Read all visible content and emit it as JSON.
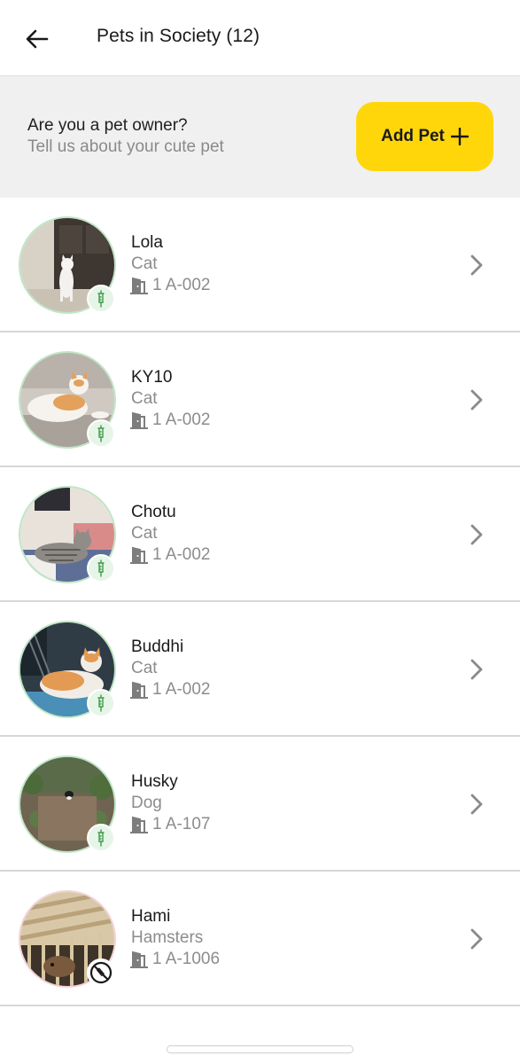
{
  "header": {
    "title": "Pets in Society (12)",
    "back_icon": "arrow-left-icon"
  },
  "banner": {
    "question": "Are you a pet owner?",
    "subtitle": "Tell us about your cute pet",
    "add_button_label": "Add Pet",
    "add_button_icon": "plus-icon",
    "accent_color": "#ffd60a"
  },
  "pets": [
    {
      "name": "Lola",
      "type": "Cat",
      "unit": "1 A-002",
      "vaccinated": true
    },
    {
      "name": "KY10",
      "type": "Cat",
      "unit": "1 A-002",
      "vaccinated": true
    },
    {
      "name": "Chotu",
      "type": "Cat",
      "unit": "1 A-002",
      "vaccinated": true
    },
    {
      "name": "Buddhi",
      "type": "Cat",
      "unit": "1 A-002",
      "vaccinated": true
    },
    {
      "name": "Husky",
      "type": "Dog",
      "unit": "1 A-107",
      "vaccinated": true
    },
    {
      "name": "Hami",
      "type": "Hamsters",
      "unit": "1 A-1006",
      "vaccinated": false
    }
  ],
  "icons": {
    "vaccinated": "syringe-icon",
    "not_vaccinated": "no-syringe-icon",
    "unit": "door-icon",
    "row_action": "chevron-right-icon"
  },
  "colors": {
    "vaccinated_badge_bg": "#e6f5e7",
    "vaccinated_ring": "#bfe6c5",
    "syringe_green": "#3f9a4c"
  }
}
